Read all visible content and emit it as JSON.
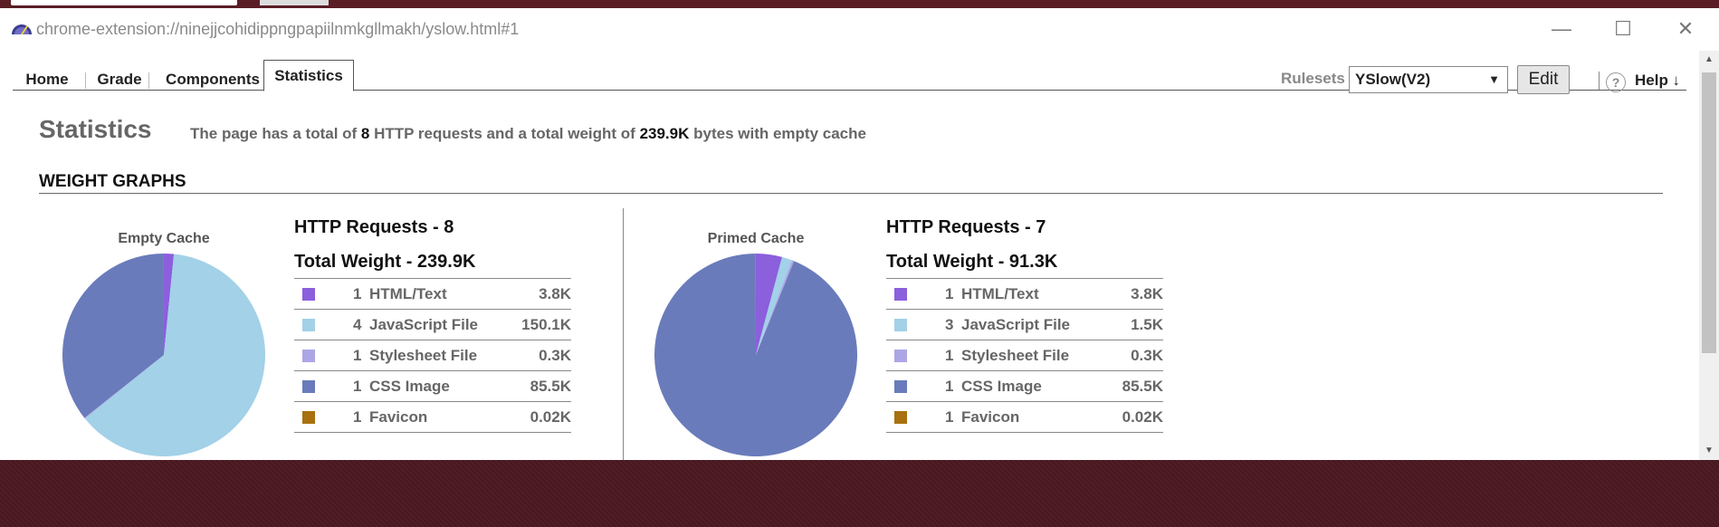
{
  "window": {
    "url": "chrome-extension://ninejjcohidippngpapiilnmkgllmakh/yslow.html#1",
    "controls": [
      "—",
      "☐",
      "✕"
    ]
  },
  "tabs": [
    {
      "label": "Home"
    },
    {
      "label": "Grade"
    },
    {
      "label": "Components"
    },
    {
      "label": "Statistics",
      "active": true
    }
  ],
  "toolbar": {
    "rulesets_label": "Rulesets",
    "ruleset_selected": "YSlow(V2)",
    "edit_label": "Edit",
    "help_label": "Help ↓",
    "help_icon_glyph": "?"
  },
  "page": {
    "title": "Statistics",
    "summary": {
      "prefix": "The page has a total of ",
      "requests": "8",
      "middle": " HTTP requests and a total weight of ",
      "weight": "239.9K",
      "suffix": " bytes with empty cache"
    },
    "section_title": "WEIGHT GRAPHS"
  },
  "colors": {
    "html": "#8c5fdd",
    "js": "#a2d1e8",
    "css": "#ada6e6",
    "cssimage": "#6a7bbb",
    "favicon": "#a8700e"
  },
  "empty_cache": {
    "pie_label": "Empty Cache",
    "requests_title": "HTTP Requests - 8",
    "weight_title": "Total Weight - 239.9K",
    "rows": [
      {
        "count": "1",
        "type": "HTML/Text",
        "size": "3.8K",
        "color_key": "html"
      },
      {
        "count": "4",
        "type": "JavaScript File",
        "size": "150.1K",
        "color_key": "js"
      },
      {
        "count": "1",
        "type": "Stylesheet File",
        "size": "0.3K",
        "color_key": "css"
      },
      {
        "count": "1",
        "type": "CSS Image",
        "size": "85.5K",
        "color_key": "cssimage"
      },
      {
        "count": "1",
        "type": "Favicon",
        "size": "0.02K",
        "color_key": "favicon"
      }
    ]
  },
  "primed_cache": {
    "pie_label": "Primed Cache",
    "requests_title": "HTTP Requests - 7",
    "weight_title": "Total Weight - 91.3K",
    "rows": [
      {
        "count": "1",
        "type": "HTML/Text",
        "size": "3.8K",
        "color_key": "html"
      },
      {
        "count": "3",
        "type": "JavaScript File",
        "size": "1.5K",
        "color_key": "js"
      },
      {
        "count": "1",
        "type": "Stylesheet File",
        "size": "0.3K",
        "color_key": "css"
      },
      {
        "count": "1",
        "type": "CSS Image",
        "size": "85.5K",
        "color_key": "cssimage"
      },
      {
        "count": "1",
        "type": "Favicon",
        "size": "0.02K",
        "color_key": "favicon"
      }
    ]
  },
  "chart_data": [
    {
      "type": "pie",
      "title": "Empty Cache",
      "labels": [
        "HTML/Text",
        "JavaScript File",
        "Stylesheet File",
        "CSS Image",
        "Favicon"
      ],
      "values": [
        3.8,
        150.1,
        0.3,
        85.5,
        0.02
      ],
      "unit": "K"
    },
    {
      "type": "pie",
      "title": "Primed Cache",
      "labels": [
        "HTML/Text",
        "JavaScript File",
        "Stylesheet File",
        "CSS Image",
        "Favicon"
      ],
      "values": [
        3.8,
        1.5,
        0.3,
        85.5,
        0.02
      ],
      "unit": "K"
    }
  ]
}
